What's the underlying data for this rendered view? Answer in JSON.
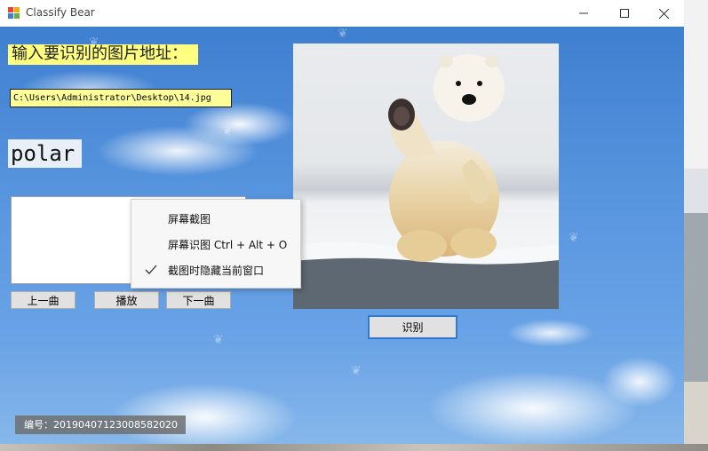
{
  "window": {
    "title": "Classify Bear",
    "controls": {
      "minimize": "—",
      "maximize": "☐",
      "close": "✕"
    }
  },
  "form": {
    "prompt_label": "输入要识别的图片地址：",
    "path_value": "C:\\Users\\Administrator\\Desktop\\14.jpg",
    "result_label": "polar",
    "buttons": {
      "prev": "上一曲",
      "play": "播放",
      "next": "下一曲",
      "recognize": "识别"
    },
    "serial_label": "编号：20190407123008582020"
  },
  "context_menu": {
    "items": [
      {
        "label": "屏幕截图",
        "checked": false
      },
      {
        "label": "屏幕识图 Ctrl + Alt + O",
        "checked": false
      },
      {
        "label": "截图时隐藏当前窗口",
        "checked": true
      }
    ]
  },
  "icons": {
    "app": "app-icon",
    "check": "checkmark-icon",
    "bear_image": "polar-bear-image"
  },
  "colors": {
    "label_highlight": "#ffff80",
    "input_background": "#ffff99",
    "accent_border": "#2e7bd3"
  }
}
